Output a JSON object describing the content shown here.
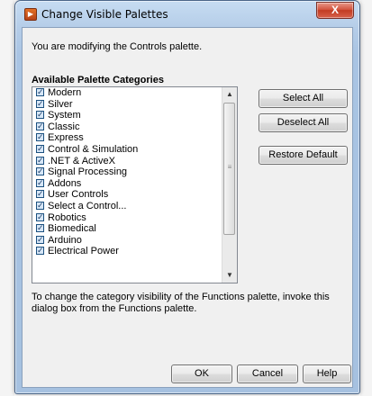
{
  "window": {
    "title": "Change Visible Palettes",
    "icon": "labview-app-icon",
    "close_glyph": "X"
  },
  "content": {
    "info_text": "You are modifying the Controls palette.",
    "section_heading": "Available Palette Categories",
    "categories": [
      {
        "label": "Modern",
        "checked": true
      },
      {
        "label": "Silver",
        "checked": true
      },
      {
        "label": "System",
        "checked": true
      },
      {
        "label": "Classic",
        "checked": true
      },
      {
        "label": "Express",
        "checked": true
      },
      {
        "label": "Control & Simulation",
        "checked": true
      },
      {
        "label": ".NET & ActiveX",
        "checked": true
      },
      {
        "label": "Signal Processing",
        "checked": true
      },
      {
        "label": "Addons",
        "checked": true
      },
      {
        "label": "User Controls",
        "checked": true
      },
      {
        "label": "Select a Control...",
        "checked": true
      },
      {
        "label": "Robotics",
        "checked": true
      },
      {
        "label": "Biomedical",
        "checked": true
      },
      {
        "label": "Arduino",
        "checked": true
      },
      {
        "label": "Electrical Power",
        "checked": true
      }
    ],
    "check_glyph": "✓",
    "scroll_up_glyph": "▲",
    "scroll_down_glyph": "▼",
    "grip_glyph": "≡",
    "footer_note": "To change the category visibility of the Functions palette, invoke this dialog box from the Functions palette."
  },
  "buttons": {
    "select_all": "Select All",
    "deselect_all": "Deselect All",
    "restore_default": "Restore Default",
    "ok": "OK",
    "cancel": "Cancel",
    "help": "Help"
  },
  "colors": {
    "title_bar": "#b5cde8",
    "close_button": "#c23c22",
    "checkbox_fill": "#d6e6f6"
  }
}
